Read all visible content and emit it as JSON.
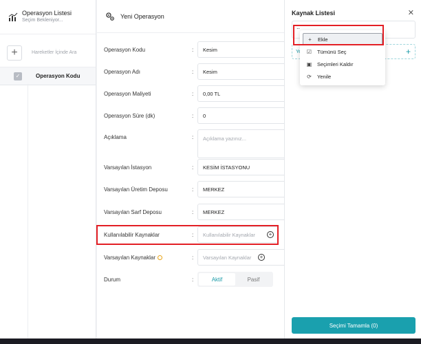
{
  "left_panel": {
    "title": "Operasyon Listesi",
    "subtitle": "Seçim Bekleniyor...",
    "add_label": "+",
    "search_placeholder": "Hareketler İçinde Ara",
    "column_header": "Operasyon Kodu"
  },
  "form": {
    "title": "Yeni Operasyon",
    "colon": ":",
    "fields": [
      {
        "label": "Operasyon Kodu",
        "value": "Kesim"
      },
      {
        "label": "Operasyon Adı",
        "value": "Kesim"
      },
      {
        "label": "Operasyon Maliyeti",
        "value": "0,00 TL"
      },
      {
        "label": "Operasyon Süre (dk)",
        "value": "0"
      },
      {
        "label": "Açıklama",
        "placeholder": "Açıklama yazınız..."
      },
      {
        "label": "Varsayılan İstasyon",
        "value": "KESİM İSTASYONU"
      },
      {
        "label": "Varsayılan Üretim Deposu",
        "value": "MERKEZ"
      },
      {
        "label": "Varsayılan Sarf Deposu",
        "value": "MERKEZ"
      },
      {
        "label": "Kullanılabilir Kaynaklar",
        "placeholder": "Kullanılabilir Kaynaklar"
      },
      {
        "label": "Varsayılan Kaynaklar",
        "placeholder": "Varsayılan Kaynaklar"
      }
    ],
    "status": {
      "label": "Durum",
      "active": "Aktif",
      "passive": "Pasif"
    }
  },
  "resource_panel": {
    "title": "Kaynak Listesi",
    "close": "✕",
    "input_value": "..",
    "bar_label": "Ye",
    "add_label": "+",
    "footer_button": "Seçimi Tamamla (0)"
  },
  "context_menu": {
    "items": [
      {
        "label": "Ekle",
        "icon": "+"
      },
      {
        "label": "Tümünü Seç",
        "icon": "☑"
      },
      {
        "label": "Seçimleri Kaldır",
        "icon": "▣"
      },
      {
        "label": "Yenile",
        "icon": "⟳"
      }
    ]
  },
  "colors": {
    "accent": "#1aa0ae",
    "highlight": "#e31e24"
  }
}
